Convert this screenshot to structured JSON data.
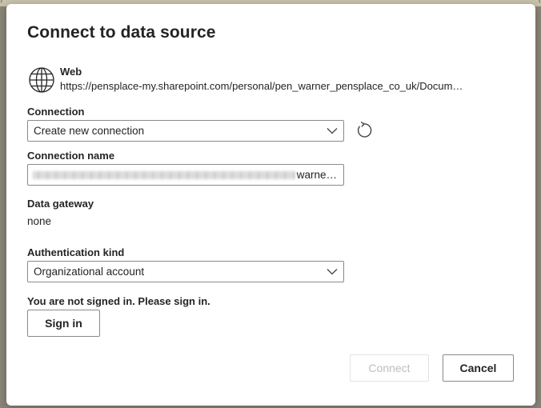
{
  "dialog": {
    "title": "Connect to data source",
    "source": {
      "type": "Web",
      "url": "https://pensplace-my.sharepoint.com/personal/pen_warner_pensplace_co_uk/Docum…",
      "icon": "globe-icon"
    },
    "connection": {
      "label": "Connection",
      "value": "Create new connection",
      "refresh_icon": "refresh-icon"
    },
    "connection_name": {
      "label": "Connection name",
      "visible_value": "warne…"
    },
    "data_gateway": {
      "label": "Data gateway",
      "value": "none"
    },
    "authentication": {
      "label": "Authentication kind",
      "value": "Organizational account"
    },
    "signin": {
      "message": "You are not signed in. Please sign in.",
      "button_label": "Sign in"
    },
    "footer": {
      "connect_label": "Connect",
      "cancel_label": "Cancel"
    }
  }
}
